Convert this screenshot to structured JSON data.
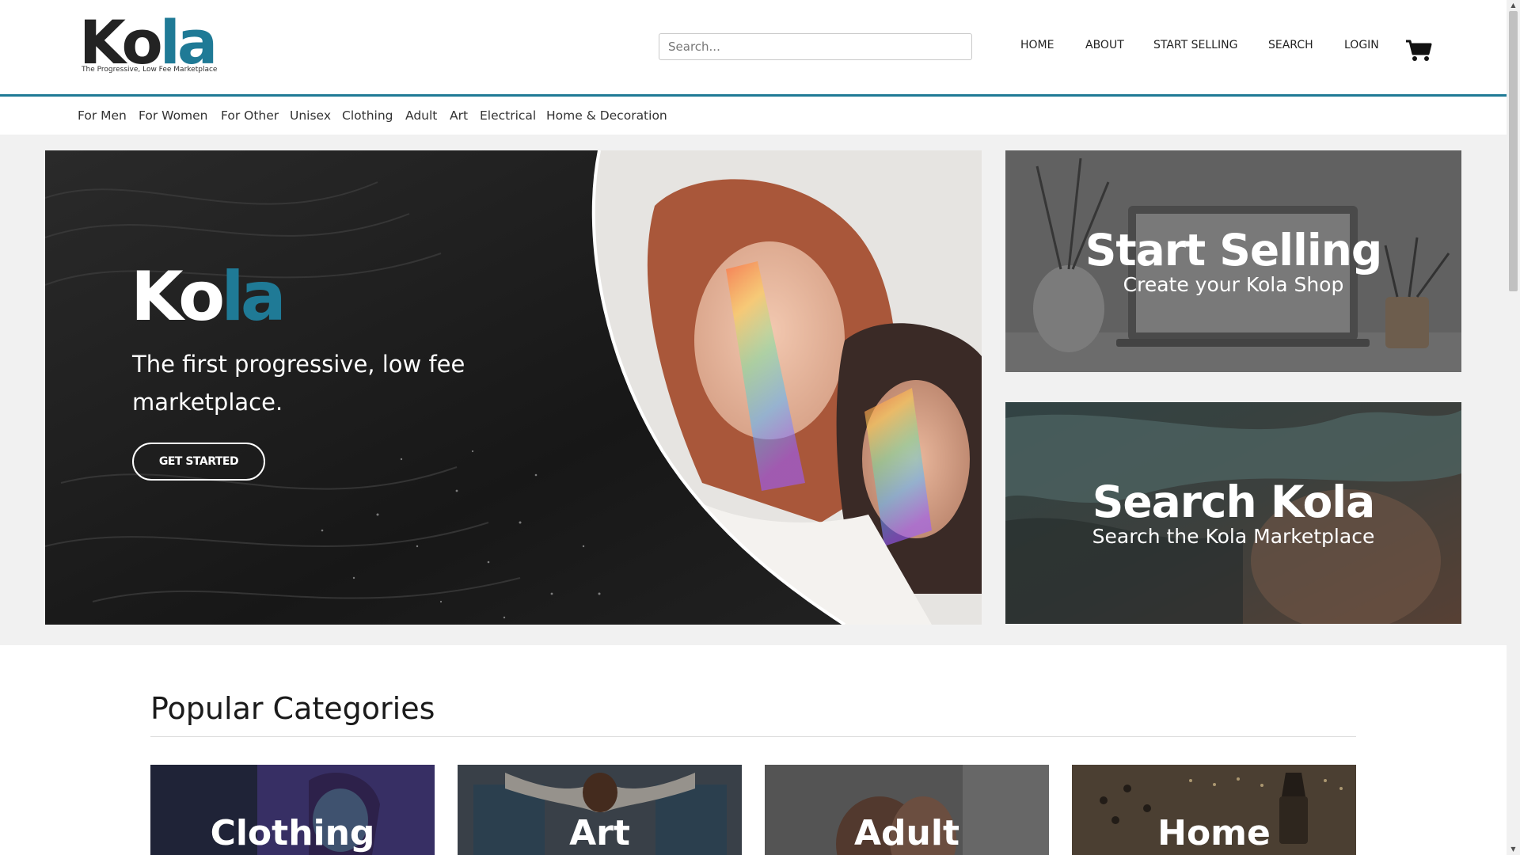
{
  "header": {
    "logo": {
      "part1": "Ko",
      "part2": "la",
      "tagline": "The Progressive, Low Fee Marketplace"
    },
    "search_placeholder": "Search...",
    "nav": [
      {
        "label": "HOME"
      },
      {
        "label": "ABOUT"
      },
      {
        "label": "START SELLING"
      },
      {
        "label": "SEARCH"
      },
      {
        "label": "LOGIN"
      }
    ],
    "cart_icon": "shopping-cart-icon"
  },
  "category_bar": [
    {
      "label": "For Men"
    },
    {
      "label": "For Women"
    },
    {
      "label": "For Other"
    },
    {
      "label": "Unisex"
    },
    {
      "label": "Clothing"
    },
    {
      "label": "Adult"
    },
    {
      "label": "Art"
    },
    {
      "label": "Electrical"
    },
    {
      "label": "Home & Decoration"
    }
  ],
  "hero": {
    "logo_part1": "Ko",
    "logo_part2": "la",
    "tagline": "The first progressive, low fee marketplace.",
    "button_label": "GET STARTED"
  },
  "promos": [
    {
      "title": "Start Selling",
      "subtitle": "Create your Kola Shop"
    },
    {
      "title": "Search Kola",
      "subtitle": "Search the Kola Marketplace"
    }
  ],
  "popular": {
    "title": "Popular Categories",
    "tiles": [
      {
        "label": "Clothing"
      },
      {
        "label": "Art"
      },
      {
        "label": "Adult"
      },
      {
        "label": "Home"
      }
    ]
  },
  "colors": {
    "brand_teal": "#1f7a96",
    "logo_dark": "#232323",
    "band_gray": "#f1f1f1"
  }
}
